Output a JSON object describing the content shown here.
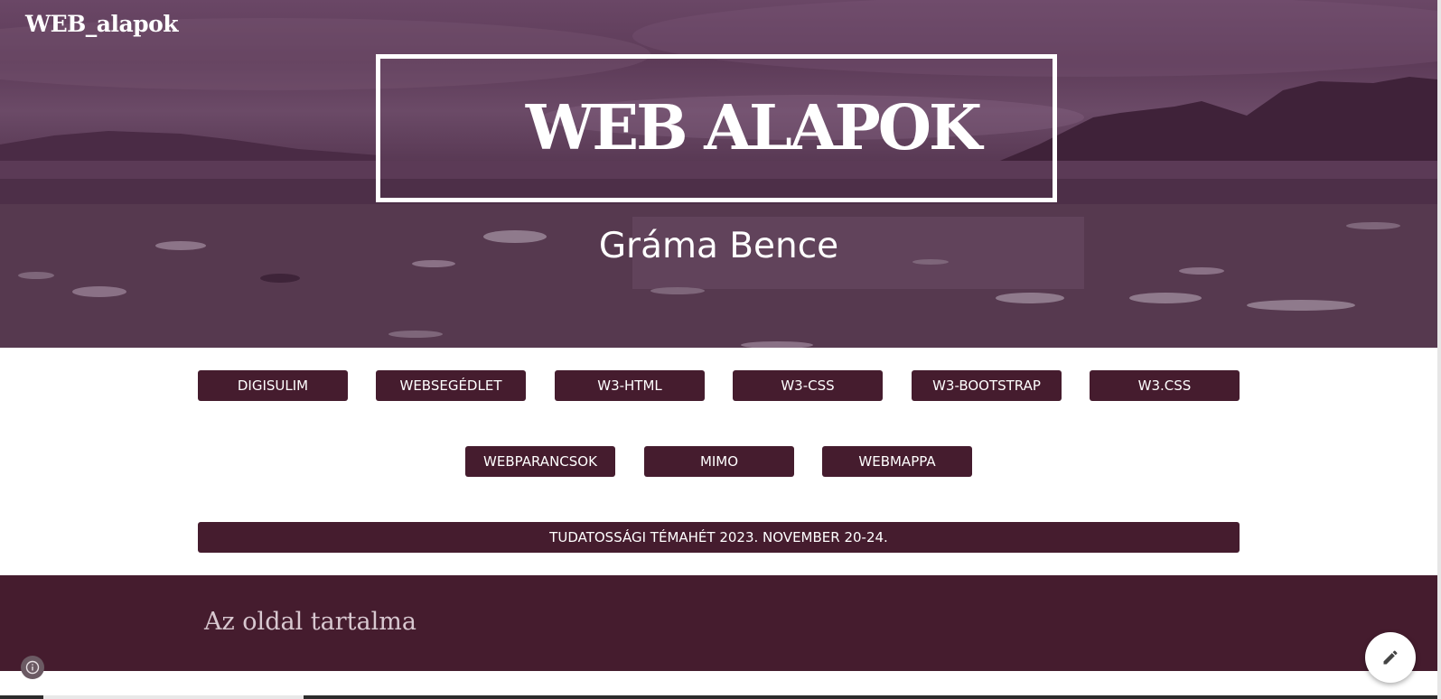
{
  "site": {
    "title": "WEB_alapok"
  },
  "hero": {
    "heading": "WEB ALAPOK",
    "subtitle": "Gráma Bence"
  },
  "nav": {
    "row1": [
      "DIGISULIM",
      "WEBSEGÉDLET",
      "W3-HTML",
      "W3-CSS",
      "W3-BOOTSTRAP",
      "W3.CSS"
    ],
    "row2": [
      "WEBPARANCSOK",
      "MIMO",
      "WEBMAPPA"
    ],
    "banner": "TUDATOSSÁGI TÉMAHÉT 2023. NOVEMBER 20-24."
  },
  "section": {
    "heading": "Az oldal tartalma"
  },
  "icons": {
    "info": "info-icon",
    "edit": "pencil-icon"
  },
  "colors": {
    "accent": "#451c2e",
    "hero_tint": "#5d3b58",
    "white": "#ffffff"
  }
}
